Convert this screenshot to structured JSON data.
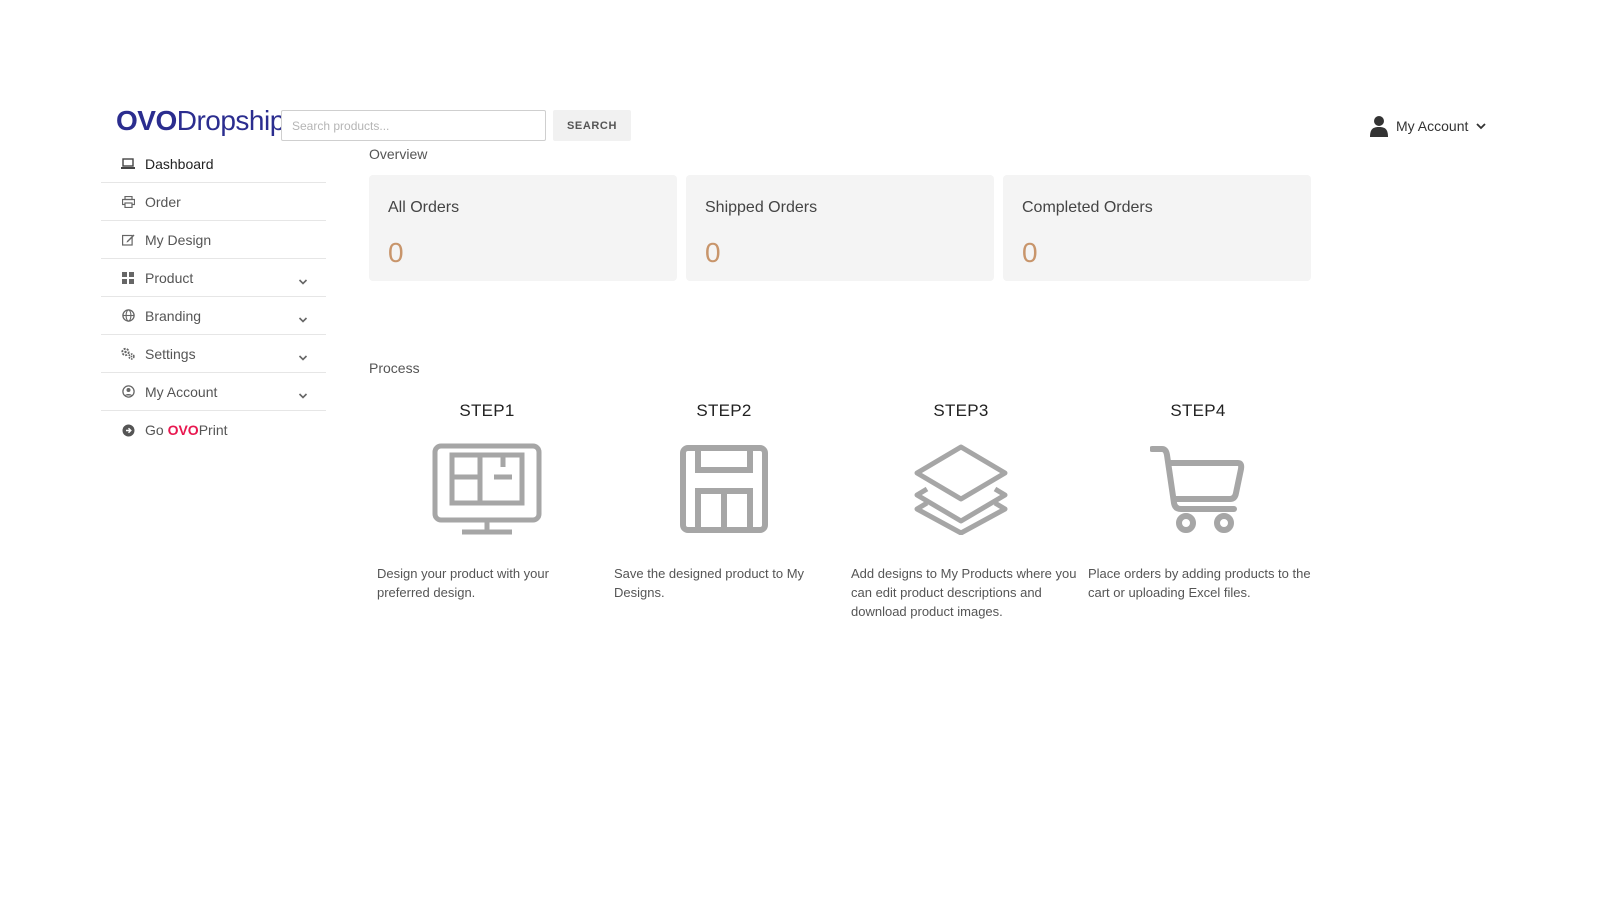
{
  "header": {
    "logo_part1": "OVO",
    "logo_part2": "Dropship",
    "search_placeholder": "Search products...",
    "search_value": "",
    "search_button_label": "SEARCH",
    "account_label": "My Account"
  },
  "sidebar": {
    "items": [
      {
        "label": "Dashboard",
        "icon": "laptop-icon",
        "has_chevron": false,
        "active": true
      },
      {
        "label": "Order",
        "icon": "printer-icon",
        "has_chevron": false
      },
      {
        "label": "My Design",
        "icon": "edit-icon",
        "has_chevron": false
      },
      {
        "label": "Product",
        "icon": "grid-icon",
        "has_chevron": true
      },
      {
        "label": "Branding",
        "icon": "globe-icon",
        "has_chevron": true
      },
      {
        "label": "Settings",
        "icon": "gears-icon",
        "has_chevron": true
      },
      {
        "label": "My Account",
        "icon": "user-circle-icon",
        "has_chevron": true
      }
    ],
    "go": {
      "prefix": "Go ",
      "brand": "OVO",
      "suffix": "Print",
      "icon": "arrow-circle-icon"
    }
  },
  "overview": {
    "title": "Overview",
    "cards": [
      {
        "title": "All Orders",
        "value": "0"
      },
      {
        "title": "Shipped Orders",
        "value": "0"
      },
      {
        "title": "Completed Orders",
        "value": "0"
      }
    ]
  },
  "process": {
    "title": "Process",
    "steps": [
      {
        "title": "STEP1",
        "icon": "monitor-design-icon",
        "desc": "Design your product with your preferred design."
      },
      {
        "title": "STEP2",
        "icon": "floppy-save-icon",
        "desc": "Save the designed product to My Designs."
      },
      {
        "title": "STEP3",
        "icon": "layers-icon",
        "desc": "Add designs to My Products where you can edit product descriptions and download product images."
      },
      {
        "title": "STEP4",
        "icon": "cart-icon",
        "desc": "Place orders by adding products to the cart or uploading Excel files."
      }
    ]
  },
  "colors": {
    "brand": "#2b2d8f",
    "brand_accent": "#e8174f",
    "card_bg": "#f4f4f4",
    "card_value": "#c8956b",
    "icon_gray": "#a6a6a6"
  }
}
